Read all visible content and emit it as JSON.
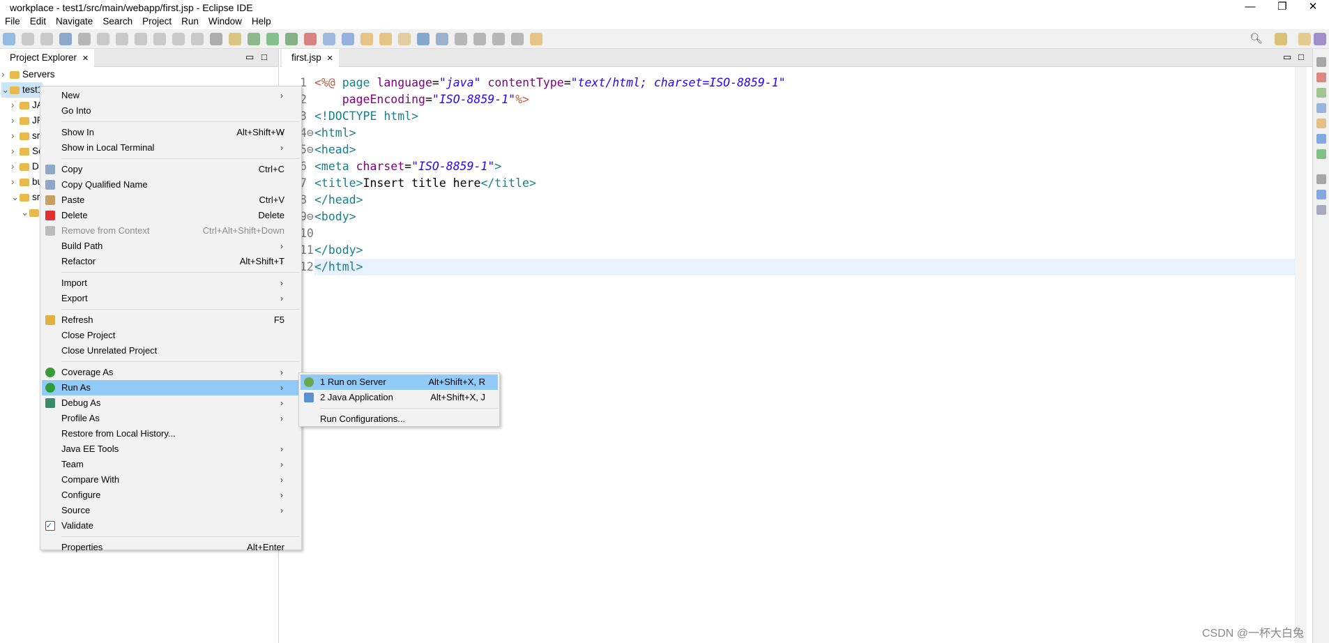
{
  "window": {
    "title": "workplace - test1/src/main/webapp/first.jsp - Eclipse IDE",
    "minimize": "—",
    "restore": "❐",
    "close": "✕"
  },
  "menubar": [
    "File",
    "Edit",
    "Navigate",
    "Search",
    "Project",
    "Run",
    "Window",
    "Help"
  ],
  "project_explorer": {
    "tab": "Project Explorer",
    "close": "✕",
    "tree": [
      {
        "label": "Servers",
        "level": 0
      },
      {
        "label": "test1",
        "level": 0
      },
      {
        "label": "JA",
        "level": 1
      },
      {
        "label": "JR",
        "level": 1
      },
      {
        "label": "sr",
        "level": 1
      },
      {
        "label": "Se",
        "level": 1
      },
      {
        "label": "D",
        "level": 1
      },
      {
        "label": "bu",
        "level": 1
      },
      {
        "label": "sr",
        "level": 1
      },
      {
        "label": "",
        "level": 2
      }
    ]
  },
  "editor": {
    "tab": "first.jsp",
    "close": "✕",
    "lines": [
      {
        "n": "1",
        "html": "<span class='jsp'>&lt;%@</span> <span class='tag'>page</span> <span class='attr'>language</span>=<span class='str'>\"java\"</span> <span class='attr'>contentType</span>=<span class='str'>\"text/html; charset=ISO-8859-1\"</span>"
      },
      {
        "n": "2",
        "html": "    <span class='attr'>pageEncoding</span>=<span class='str'>\"ISO-8859-1\"</span><span class='jsp'>%&gt;</span>"
      },
      {
        "n": "3",
        "html": "<span class='tag'>&lt;!DOCTYPE html&gt;</span>"
      },
      {
        "n": "4⊖",
        "html": "<span class='tag'>&lt;html&gt;</span>"
      },
      {
        "n": "5⊖",
        "html": "<span class='tag'>&lt;head&gt;</span>"
      },
      {
        "n": "6",
        "html": "<span class='tag'>&lt;meta</span> <span class='attr'>charset</span>=<span class='str'>\"ISO-8859-1\"</span><span class='tag'>&gt;</span>"
      },
      {
        "n": "7",
        "html": "<span class='tag'>&lt;title&gt;</span>Insert title here<span class='tag'>&lt;/title&gt;</span>"
      },
      {
        "n": "8",
        "html": "<span class='tag'>&lt;/head&gt;</span>"
      },
      {
        "n": "9⊖",
        "html": "<span class='tag'>&lt;body&gt;</span>"
      },
      {
        "n": "10",
        "html": ""
      },
      {
        "n": "11",
        "html": "<span class='tag'>&lt;/body&gt;</span>"
      },
      {
        "n": "12",
        "html": "<span class='tag'>&lt;/html&gt;</span>"
      }
    ],
    "current_line": "12"
  },
  "context_menu": [
    {
      "label": "New",
      "arrow": true
    },
    {
      "label": "Go Into"
    },
    {
      "sep": true
    },
    {
      "label": "Show In",
      "shortcut": "Alt+Shift+W",
      "arrow": true
    },
    {
      "label": "Show in Local Terminal",
      "arrow": true
    },
    {
      "sep": true
    },
    {
      "label": "Copy",
      "shortcut": "Ctrl+C",
      "icon": "copy-icon"
    },
    {
      "label": "Copy Qualified Name",
      "icon": "copy-qualified-icon"
    },
    {
      "label": "Paste",
      "shortcut": "Ctrl+V",
      "icon": "paste-icon"
    },
    {
      "label": "Delete",
      "shortcut": "Delete",
      "icon": "delete-icon"
    },
    {
      "label": "Remove from Context",
      "shortcut": "Ctrl+Alt+Shift+Down",
      "disabled": true,
      "icon": "remove-context-icon"
    },
    {
      "label": "Build Path",
      "arrow": true
    },
    {
      "label": "Refactor",
      "shortcut": "Alt+Shift+T",
      "arrow": true
    },
    {
      "sep": true
    },
    {
      "label": "Import",
      "arrow": true
    },
    {
      "label": "Export",
      "arrow": true
    },
    {
      "sep": true
    },
    {
      "label": "Refresh",
      "shortcut": "F5",
      "icon": "refresh-icon"
    },
    {
      "label": "Close Project"
    },
    {
      "label": "Close Unrelated Project"
    },
    {
      "sep": true
    },
    {
      "label": "Coverage As",
      "arrow": true,
      "icon": "coverage-icon"
    },
    {
      "label": "Run As",
      "arrow": true,
      "selected": true,
      "icon": "run-icon"
    },
    {
      "label": "Debug As",
      "arrow": true,
      "icon": "debug-icon"
    },
    {
      "label": "Profile As",
      "arrow": true
    },
    {
      "label": "Restore from Local History..."
    },
    {
      "label": "Java EE Tools",
      "arrow": true
    },
    {
      "label": "Team",
      "arrow": true
    },
    {
      "label": "Compare With",
      "arrow": true
    },
    {
      "label": "Configure",
      "arrow": true
    },
    {
      "label": "Source",
      "arrow": true
    },
    {
      "label": "Validate",
      "icon": "checkbox-icon"
    },
    {
      "sep": true
    },
    {
      "label": "Properties",
      "shortcut": "Alt+Enter"
    }
  ],
  "run_as_submenu": [
    {
      "label": "1 Run on Server",
      "shortcut": "Alt+Shift+X, R",
      "selected": true,
      "icon": "server-run-icon"
    },
    {
      "label": "2 Java Application",
      "shortcut": "Alt+Shift+X, J",
      "icon": "java-app-icon"
    },
    {
      "sep": true
    },
    {
      "label": "Run Configurations..."
    }
  ],
  "watermark": "CSDN @一杯大白兔",
  "colors": {
    "selection": "#91c9f7",
    "current_line": "#e8f2fe",
    "tag": "#17808c",
    "attribute": "#7f007f",
    "string": "#2a00ff"
  }
}
